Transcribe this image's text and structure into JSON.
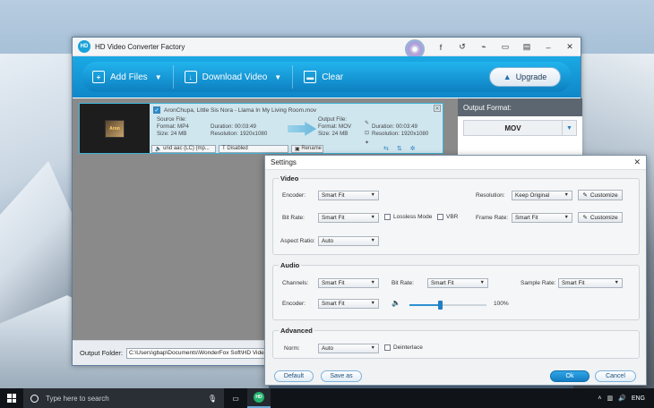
{
  "app": {
    "title": "HD Video Converter Factory",
    "logo_text": "HD",
    "colors": {
      "toolbar": "#1aa9e4",
      "accent": "#2d8fcf",
      "taskbar": "#101418"
    }
  },
  "titlebar": {
    "buttons": [
      {
        "name": "facebook-icon",
        "glyph": "f"
      },
      {
        "name": "undo-icon",
        "glyph": "↺"
      },
      {
        "name": "brush-icon",
        "glyph": "⌁"
      },
      {
        "name": "chat-icon",
        "glyph": "▭"
      },
      {
        "name": "menu-icon",
        "glyph": "▤"
      },
      {
        "name": "minimize-icon",
        "glyph": "–"
      },
      {
        "name": "close-icon",
        "glyph": "✕"
      }
    ]
  },
  "toolbar": {
    "add_files": "Add Files",
    "download_video": "Download Video",
    "clear": "Clear",
    "upgrade": "Upgrade"
  },
  "file": {
    "name": "AronChupa, Little Sis Nora - Llama In My Living Room.mov",
    "thumb_text": "Aron",
    "source": {
      "label": "Source File:",
      "format": "Format: MP4",
      "duration": "Duration: 00:03:49",
      "size": "Size: 24 MB",
      "resolution": "Resolution: 1920x1080"
    },
    "output": {
      "label": "Output File:",
      "format": "Format: MOV",
      "duration": "Duration: 00:03:49",
      "size": "Size: 24 MB",
      "resolution": "Resolution: 1920x1080"
    },
    "audio_track": "und aac (LC) (mp...",
    "subtitle": "Disabled",
    "rename": "Rename"
  },
  "output_format": {
    "label": "Output Format:",
    "value": "MOV"
  },
  "output_folder": {
    "label": "Output Folder:",
    "path": "C:\\Users\\gbap\\Documents\\WonderFox Soft\\HD Video C"
  },
  "settings": {
    "title": "Settings",
    "video": {
      "title": "Video",
      "encoder_label": "Encoder:",
      "encoder_value": "Smart Fit",
      "resolution_label": "Resolution:",
      "resolution_value": "Keep Original",
      "customize1": "Customize",
      "bitrate_label": "Bit Rate:",
      "bitrate_value": "Smart Fit",
      "lossless": "Lossless Mode",
      "vbr": "VBR",
      "framerate_label": "Frame Rate:",
      "framerate_value": "Smart Fit",
      "customize2": "Customize",
      "aspect_label": "Aspect Ratio:",
      "aspect_value": "Auto"
    },
    "audio": {
      "title": "Audio",
      "channels_label": "Channels:",
      "channels_value": "Smart Fit",
      "bitrate_label": "Bit Rate:",
      "bitrate_value": "Smart Fit",
      "samplerate_label": "Sample Rate:",
      "samplerate_value": "Smart Fit",
      "encoder_label": "Encoder:",
      "encoder_value": "Smart Fit",
      "volume_text": "100%",
      "volume_fraction": 0.4
    },
    "advanced": {
      "title": "Advanced",
      "norm_label": "Norm:",
      "norm_value": "Auto",
      "deinterlace": "Deinterlace"
    },
    "buttons": {
      "default": "Default",
      "save_as": "Save as",
      "ok": "Ok",
      "cancel": "Cancel"
    }
  },
  "taskbar": {
    "search_placeholder": "Type here to search",
    "language": "ENG"
  }
}
